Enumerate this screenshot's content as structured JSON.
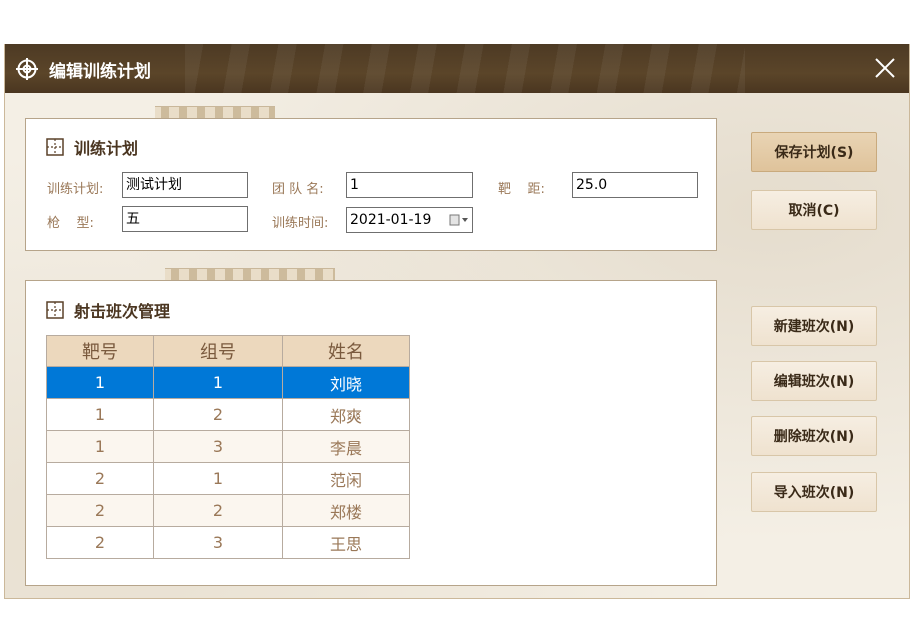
{
  "window": {
    "title": "编辑训练计划"
  },
  "plan": {
    "section_title": "训练计划",
    "name_label": "训练计划:",
    "name_value": "测试计划",
    "team_label": "团 队 名:",
    "team_value": "1",
    "distance_label": "靶    距:",
    "distance_value": "25.0",
    "gun_label": "枪    型:",
    "gun_value": "五",
    "time_label": "训练时间:",
    "time_value": "2021-01-19"
  },
  "shifts": {
    "section_title": "射击班次管理",
    "columns": [
      "靶号",
      "组号",
      "姓名"
    ],
    "rows": [
      [
        "1",
        "1",
        "刘晓"
      ],
      [
        "1",
        "2",
        "郑爽"
      ],
      [
        "1",
        "3",
        "李晨"
      ],
      [
        "2",
        "1",
        "范闲"
      ],
      [
        "2",
        "2",
        "郑楼"
      ],
      [
        "2",
        "3",
        "王思"
      ]
    ]
  },
  "buttons": {
    "save": "保存计划(S)",
    "cancel": "取消(C)",
    "new": "新建班次(N)",
    "edit": "编辑班次(N)",
    "delete": "删除班次(N)",
    "import": "导入班次(N)"
  },
  "colors": {
    "titlebar": "#4d3a24",
    "selection": "#0078d7",
    "header": "#ecd8bd"
  },
  "icons": {
    "title": "crosshair-icon",
    "close": "close-icon",
    "section": "grid-icon",
    "date": "calendar-icon"
  }
}
